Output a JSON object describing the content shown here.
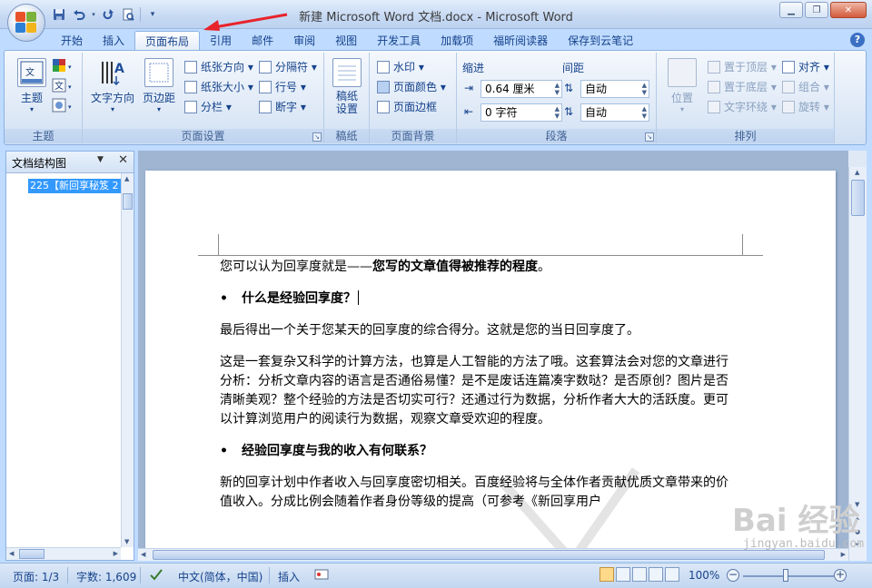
{
  "window": {
    "title": "新建 Microsoft Word 文档.docx - Microsoft Word",
    "controls": [
      "minimize",
      "restore",
      "close"
    ]
  },
  "quick_access": [
    "save-icon",
    "undo-icon",
    "redo-icon",
    "print-preview-icon",
    "customize-dropdown-icon"
  ],
  "tabs": [
    "开始",
    "插入",
    "页面布局",
    "引用",
    "邮件",
    "审阅",
    "视图",
    "开发工具",
    "加载项",
    "福昕阅读器",
    "保存到云笔记"
  ],
  "active_tab": "页面布局",
  "ribbon": {
    "theme": {
      "label": "主题",
      "button": "主题"
    },
    "page_setup": {
      "label": "页面设置",
      "text_direction": "文字方向",
      "margins": "页边距",
      "orientation": "纸张方向",
      "size": "纸张大小",
      "columns": "分栏",
      "breaks": "分隔符",
      "line_numbers": "行号",
      "hyphenation": "断字"
    },
    "draft": {
      "label": "稿纸",
      "button": "稿纸\n设置"
    },
    "page_background": {
      "label": "页面背景",
      "watermark": "水印",
      "page_color": "页面颜色",
      "page_borders": "页面边框"
    },
    "paragraph": {
      "label": "段落",
      "indent_title": "缩进",
      "spacing_title": "间距",
      "indent_left": "0.64 厘米",
      "indent_right": "0 字符",
      "spacing_before": "自动",
      "spacing_after": "自动"
    },
    "arrange": {
      "label": "排列",
      "position": "位置",
      "bring_front": "置于顶层",
      "send_back": "置于底层",
      "text_wrap": "文字环绕",
      "align": "对齐",
      "group": "组合",
      "rotate": "旋转"
    }
  },
  "nav_pane": {
    "title": "文档结构图",
    "item": "225【新回享秘笈 2"
  },
  "document": {
    "para1_prefix": "您可以认为回享度就是——",
    "para1_bold": "您写的文章值得被推荐的程度",
    "para1_suffix": "。",
    "heading1": "什么是经验回享度？",
    "para2": "最后得出一个关于您某天的回享度的综合得分。这就是您的当日回享度了。",
    "para3": "这是一套复杂又科学的计算方法，也算是人工智能的方法了哦。这套算法会对您的文章进行分析：分析文章内容的语言是否通俗易懂？是不是废话连篇凑字数哒？是否原创？图片是否清晰美观？整个经验的方法是否切实可行？还通过行为数据，分析作者大大的活跃度。更可以计算浏览用户的阅读行为数据，观察文章受欢迎的程度。",
    "heading2": "经验回享度与我的收入有何联系？",
    "para4": "新的回享计划中作者收入与回享度密切相关。百度经验将与全体作者贡献优质文章带来的价值收入。分成比例会随着作者身份等级的提高（可参考《新回享用户"
  },
  "status": {
    "page": "页面: 1/3",
    "words": "字数: 1,609",
    "language": "中文(简体，中国)",
    "mode": "插入",
    "zoom": "100%"
  },
  "watermark": {
    "site": "jingyan.baidu.com",
    "logo": "Bai 经验"
  },
  "colors": {
    "ribbon_bg": "#dde8f6",
    "accent_blue": "#15428b",
    "selection": "#3399ff",
    "annotation_red": "#e8232b"
  }
}
